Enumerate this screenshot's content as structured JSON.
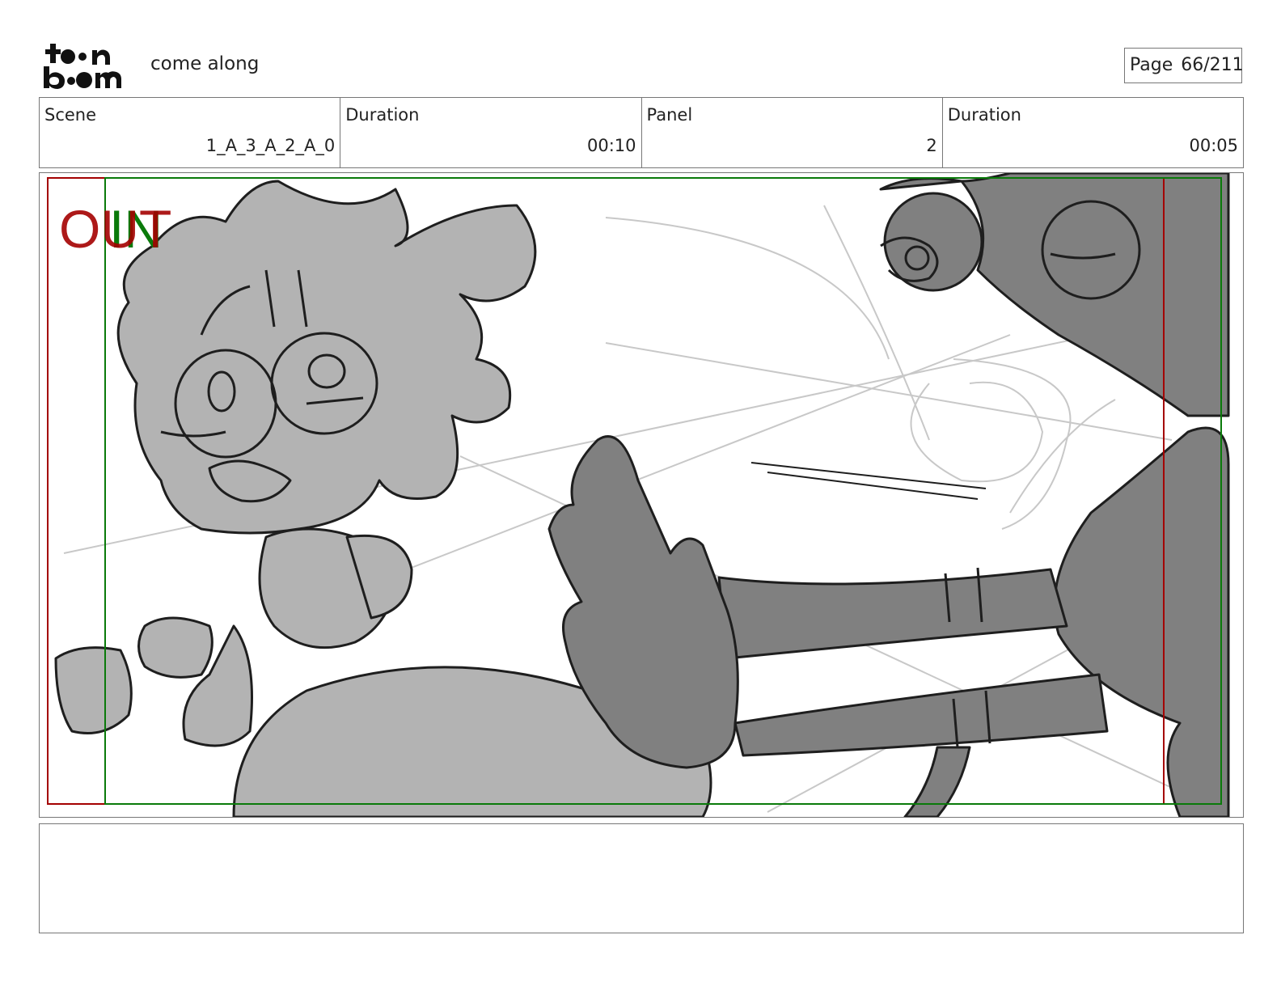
{
  "header": {
    "logo_text": "toon boom",
    "project_title": "come along",
    "page_label": "Page",
    "page_number": "66/211"
  },
  "info": {
    "scene_label": "Scene",
    "scene_value": "1_A_3_A_2_A_0",
    "scene_duration_label": "Duration",
    "scene_duration_value": "00:10",
    "panel_label": "Panel",
    "panel_value": "2",
    "panel_duration_label": "Duration",
    "panel_duration_value": "00:05"
  },
  "panel": {
    "transition_out": "OUT",
    "transition_in": "IN",
    "colors": {
      "out_guide": "#a40000",
      "in_guide": "#0a7a0a",
      "light_fill": "#b3b3b3",
      "dark_fill": "#808080"
    }
  },
  "notes": {
    "text": ""
  }
}
